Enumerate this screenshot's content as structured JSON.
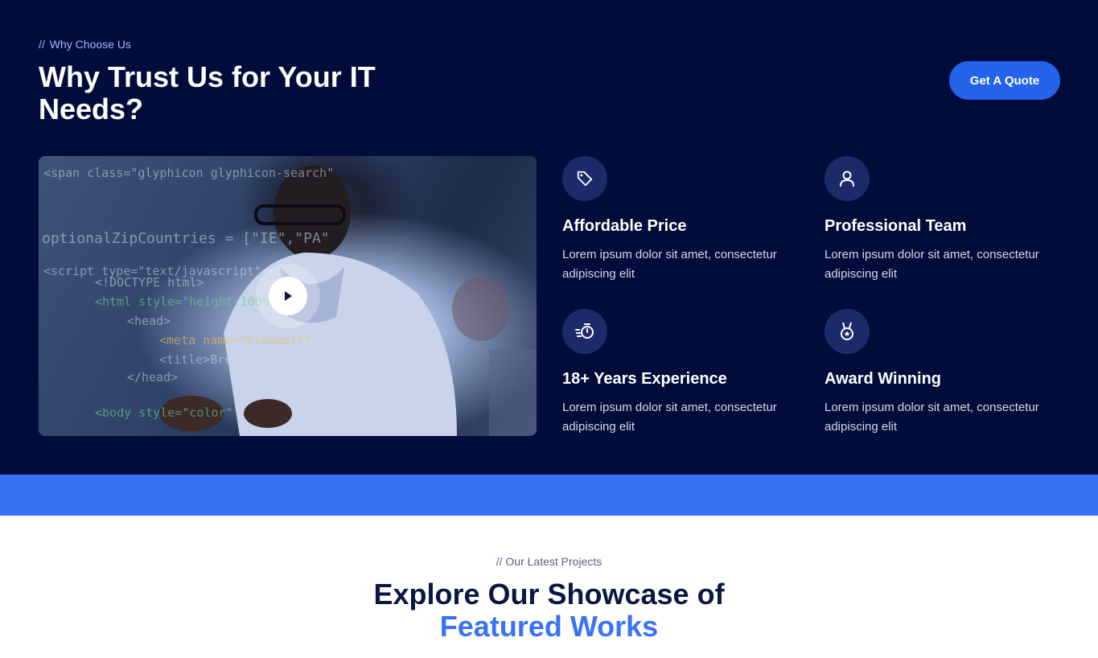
{
  "why_section": {
    "eyebrow_slashes": "//",
    "eyebrow": "Why Choose Us",
    "title": "Why Trust Us for Your IT Needs?",
    "quote_button": "Get A Quote",
    "features": [
      {
        "icon": "price-tag-icon",
        "title": "Affordable Price",
        "desc": "Lorem ipsum dolor sit amet, consectetur adipiscing elit"
      },
      {
        "icon": "user-icon",
        "title": "Professional Team",
        "desc": "Lorem ipsum dolor sit amet, consectetur adipiscing elit"
      },
      {
        "icon": "stopwatch-icon",
        "title": "18+ Years Experience",
        "desc": "Lorem ipsum dolor sit amet, consectetur adipiscing elit"
      },
      {
        "icon": "award-medal-icon",
        "title": "Award Winning",
        "desc": "Lorem ipsum dolor sit amet, consectetur adipiscing elit"
      }
    ]
  },
  "projects_section": {
    "eyebrow": "// Our Latest Projects",
    "title_line1": "Explore Our Showcase of",
    "title_line2": "Featured Works"
  },
  "colors": {
    "dark_bg": "#010c3a",
    "accent": "#2563eb",
    "band": "#3a72f5",
    "icon_circle": "#1c2a6a"
  }
}
